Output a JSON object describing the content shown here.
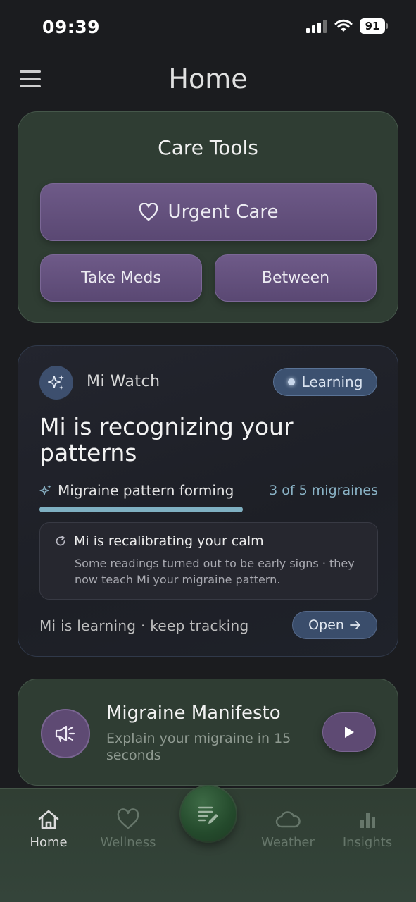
{
  "status_bar": {
    "time": "09:39",
    "battery": "91"
  },
  "header": {
    "title": "Home"
  },
  "care_tools": {
    "title": "Care Tools",
    "urgent_care_label": "Urgent Care",
    "take_meds_label": "Take Meds",
    "between_label": "Between"
  },
  "mi_watch": {
    "name": "Mi Watch",
    "status_pill": "Learning",
    "headline": "Mi is recognizing your patterns",
    "pattern_label": "Migraine pattern forming",
    "pattern_count": "3 of 5 migraines",
    "pattern_progress": 0.6,
    "recalibrate_title": "Mi is recalibrating your calm",
    "recalibrate_body": "Some readings turned out to be early signs · they now teach Mi your migraine pattern.",
    "footer_text": "Mi is learning · keep tracking",
    "open_label": "Open"
  },
  "manifesto": {
    "title": "Migraine Manifesto",
    "subtitle": "Explain your migraine in 15 seconds"
  },
  "bottom_nav": {
    "home": "Home",
    "wellness": "Wellness",
    "weather": "Weather",
    "insights": "Insights"
  },
  "colors": {
    "background": "#1b1c1f",
    "card_green": "#2f3d33",
    "button_purple": "#5e4a73",
    "accent_blue": "#7fb0c2"
  },
  "icons": {
    "menu": "hamburger-icon",
    "urgent": "heart-icon",
    "watch": "sparkles-icon",
    "recalibrate": "refresh-icon",
    "open": "arrow-right-icon",
    "manifesto": "megaphone-icon",
    "play": "play-icon",
    "fab": "note-edit-icon"
  }
}
